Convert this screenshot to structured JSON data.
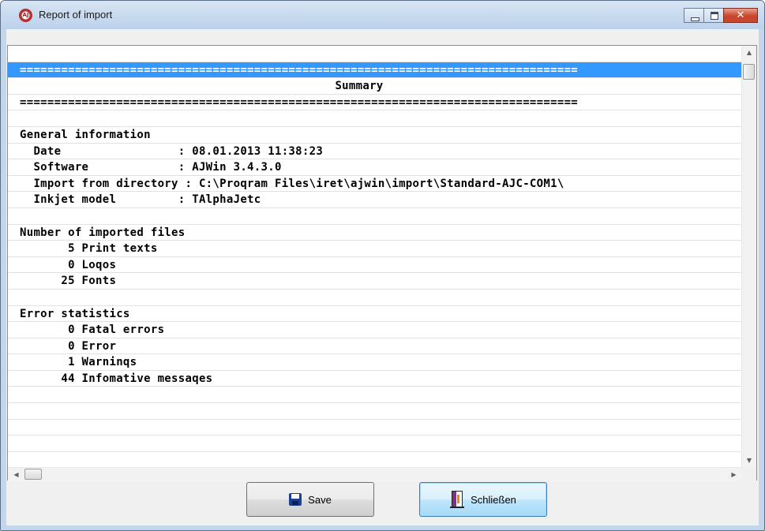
{
  "window": {
    "title": "Report of import",
    "app_icon_text": "AJ"
  },
  "report": {
    "rows": [
      {
        "text": "",
        "style": "normal"
      },
      {
        "text": "=================================================================================",
        "style": "selected"
      },
      {
        "text": "Summary",
        "style": "center"
      },
      {
        "text": "=================================================================================",
        "style": "normal"
      },
      {
        "text": "",
        "style": "normal"
      },
      {
        "text": "General information",
        "style": "normal"
      },
      {
        "text": "  Date                 : 08.01.2013 11:38:23",
        "style": "normal"
      },
      {
        "text": "  Software             : AJWin 3.4.3.0",
        "style": "normal"
      },
      {
        "text": "  Import from directory : C:\\Proqram Files\\iret\\ajwin\\import\\Standard-AJC-COM1\\",
        "style": "normal"
      },
      {
        "text": "  Inkjet model         : TAlphaJetc",
        "style": "normal"
      },
      {
        "text": "",
        "style": "normal"
      },
      {
        "text": "Number of imported files",
        "style": "normal"
      },
      {
        "text": "       5 Print texts",
        "style": "normal"
      },
      {
        "text": "       0 Loqos",
        "style": "normal"
      },
      {
        "text": "      25 Fonts",
        "style": "normal"
      },
      {
        "text": "",
        "style": "normal"
      },
      {
        "text": "Error statistics",
        "style": "normal"
      },
      {
        "text": "       0 Fatal errors",
        "style": "normal"
      },
      {
        "text": "       0 Error",
        "style": "normal"
      },
      {
        "text": "       1 Warninqs",
        "style": "normal"
      },
      {
        "text": "      44 Infomative messaqes",
        "style": "normal"
      },
      {
        "text": "",
        "style": "normal"
      },
      {
        "text": "",
        "style": "normal"
      },
      {
        "text": "",
        "style": "normal"
      },
      {
        "text": "",
        "style": "normal"
      },
      {
        "text": "",
        "style": "normal"
      }
    ]
  },
  "buttons": {
    "save_label": "Save",
    "close_label": "Schließen"
  },
  "icons": {
    "save": "floppy-disk-icon",
    "close": "exit-door-icon",
    "app": "app-logo-icon"
  },
  "colors": {
    "selection": "#3399ff",
    "titlebar": "#c9dbef",
    "close_button": "#c7452c"
  }
}
